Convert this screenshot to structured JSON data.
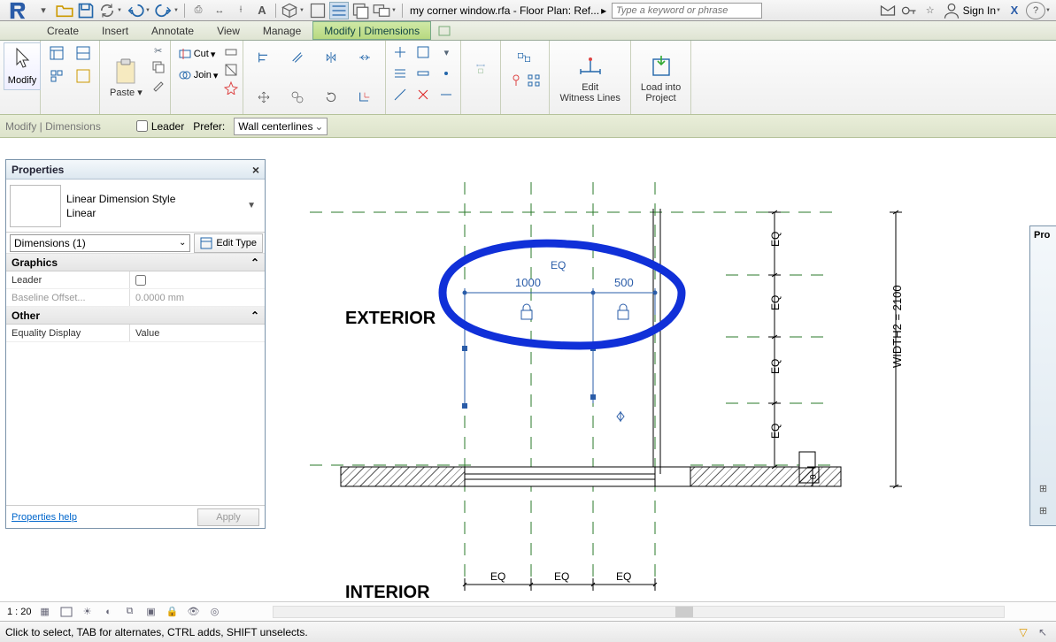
{
  "qat": {
    "title": "my corner window.rfa - Floor Plan: Ref...",
    "search_placeholder": "Type a keyword or phrase",
    "signin": "Sign In"
  },
  "menu": {
    "items": [
      "Create",
      "Insert",
      "Annotate",
      "View",
      "Manage",
      "Modify | Dimensions"
    ]
  },
  "ribbon": {
    "modify": "Modify",
    "paste": "Paste",
    "cut": "Cut",
    "join": "Join",
    "edit_witness": "Edit\nWitness Lines",
    "load_project": "Load into\nProject"
  },
  "optbar": {
    "context": "Modify | Dimensions",
    "leader": "Leader",
    "prefer": "Prefer:",
    "prefer_value": "Wall centerlines"
  },
  "palette": {
    "title": "Properties",
    "type_name": "Linear Dimension Style",
    "type_sub": "Linear",
    "selector": "Dimensions (1)",
    "edit_type": "Edit Type",
    "groups": {
      "graphics": "Graphics",
      "other": "Other"
    },
    "props": {
      "leader_k": "Leader",
      "baseline_k": "Baseline Offset...",
      "baseline_v": "0.0000 mm",
      "equality_k": "Equality Display",
      "equality_v": "Value"
    },
    "help": "Properties help",
    "apply": "Apply"
  },
  "rpalette": {
    "title": "Pro"
  },
  "canvas": {
    "exterior": "EXTERIOR",
    "interior": "INTERIOR",
    "eq": "EQ",
    "dim1": "1000",
    "dim2": "500",
    "width2": "WIDTH2 = 2100",
    "zero": "0"
  },
  "viewbar": {
    "scale": "1 : 20"
  },
  "status": {
    "hint": "Click to select, TAB for alternates, CTRL adds, SHIFT unselects."
  }
}
